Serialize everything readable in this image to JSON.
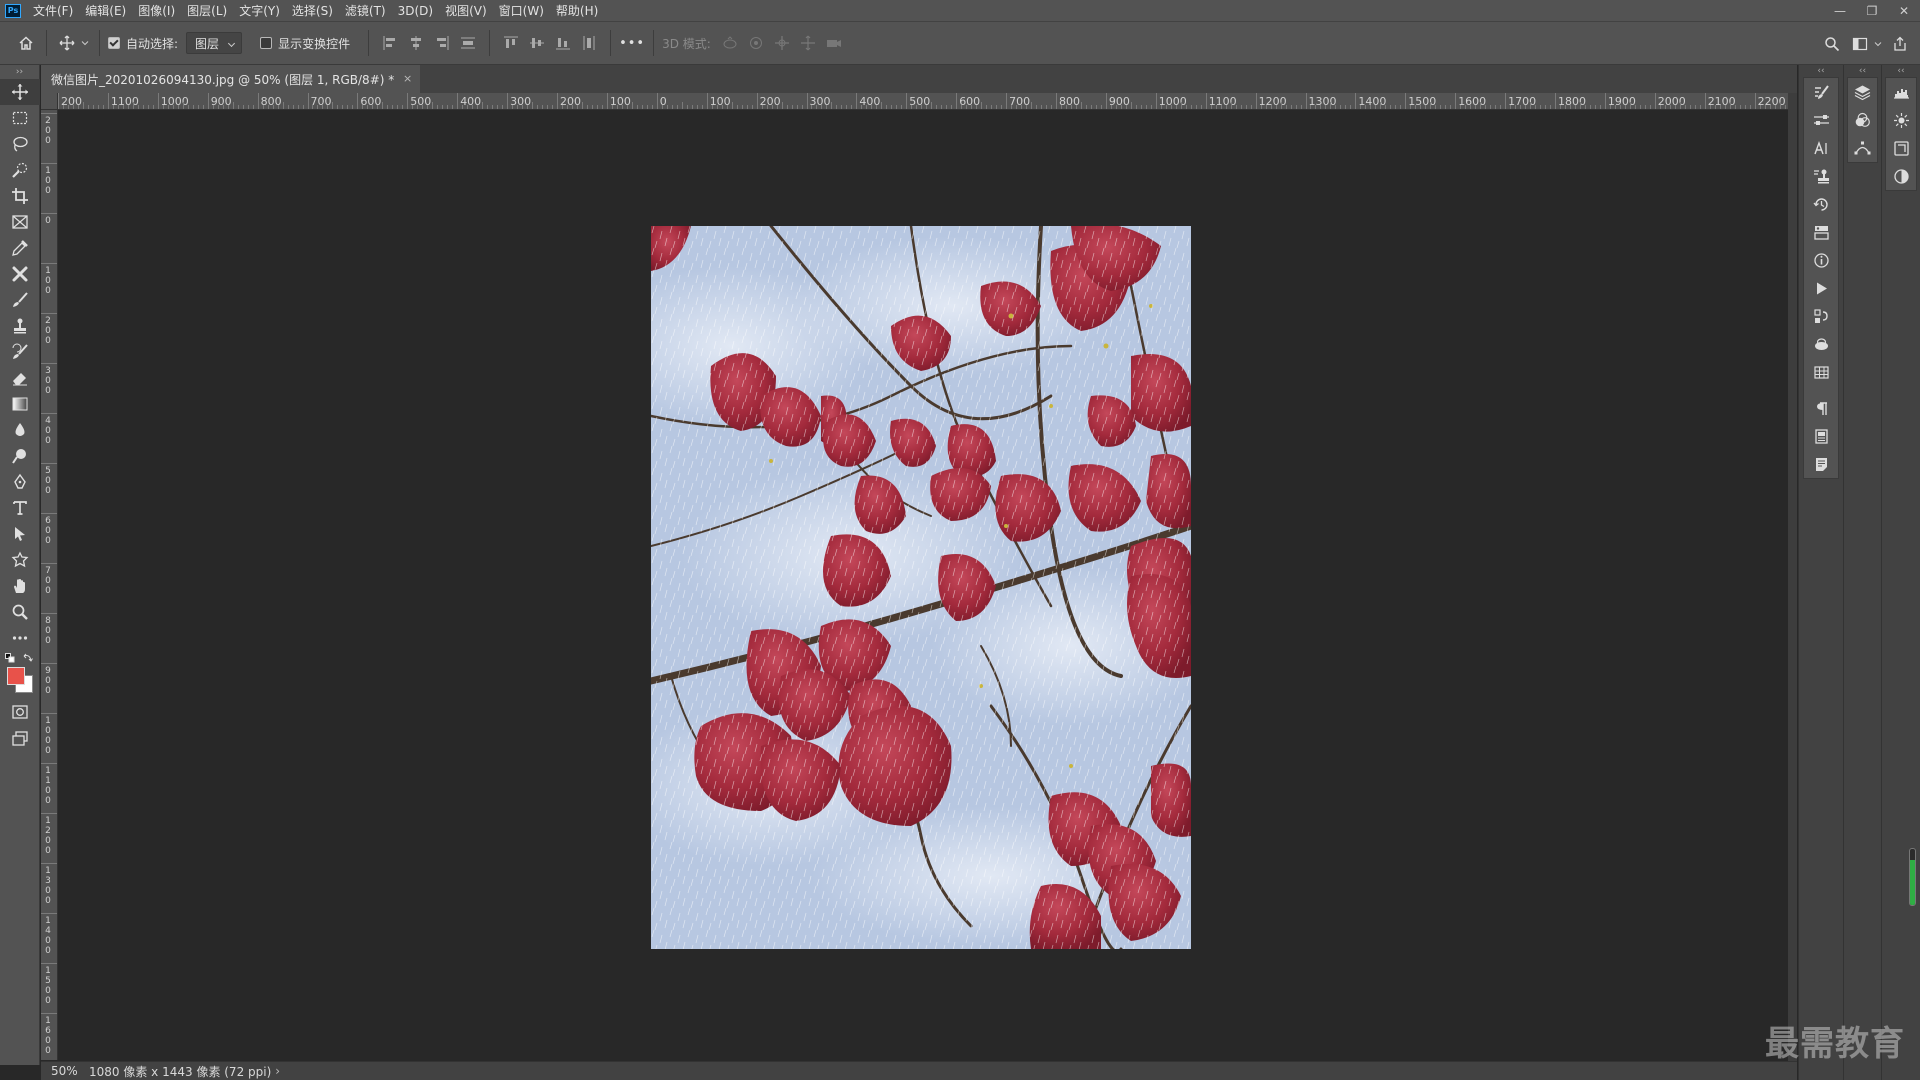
{
  "menubar": {
    "logo": "Ps",
    "items": [
      "文件(F)",
      "编辑(E)",
      "图像(I)",
      "图层(L)",
      "文字(Y)",
      "选择(S)",
      "滤镜(T)",
      "3D(D)",
      "视图(V)",
      "窗口(W)",
      "帮助(H)"
    ],
    "controls": {
      "minimize": "—",
      "restore": "❐",
      "close": "✕"
    }
  },
  "options": {
    "auto_select_label": "自动选择:",
    "auto_select_checked": true,
    "layer_select_value": "图层",
    "show_transform_label": "显示变换控件",
    "show_transform_checked": false,
    "more_label": "•••",
    "mode_3d_label": "3D 模式:"
  },
  "document": {
    "tab_title": "微信图片_20201026094130.jpg @ 50% (图层 1, RGB/8#) *",
    "close_glyph": "×"
  },
  "ruler_h_labels": [
    "200",
    "1100",
    "1000",
    "900",
    "800",
    "700",
    "600",
    "500",
    "400",
    "300",
    "200",
    "100",
    "0",
    "100",
    "200",
    "300",
    "400",
    "500",
    "600",
    "700",
    "800",
    "900",
    "1000",
    "1100",
    "1200",
    "1300",
    "1400",
    "1500",
    "1600",
    "1700",
    "1800",
    "1900",
    "2000",
    "2100",
    "2200"
  ],
  "ruler_v_labels": [
    "200",
    "100",
    "0",
    "100",
    "200",
    "300",
    "400",
    "500",
    "600",
    "700",
    "800",
    "900",
    "1000",
    "1100",
    "1200",
    "1300",
    "1400",
    "1500",
    "1600"
  ],
  "status": {
    "zoom": "50%",
    "info": "1080 像素 x 1443 像素 (72 ppi)",
    "arrow": "›"
  },
  "colors": {
    "foreground": "#e8524a",
    "background": "#ffffff",
    "ui_panel": "#535353",
    "ui_canvas": "#282828"
  },
  "tools": [
    "move-icon",
    "marquee-icon",
    "lasso-icon",
    "quick-select-icon",
    "crop-icon",
    "frame-icon",
    "eyedropper-icon",
    "healing-icon",
    "brush-icon",
    "stamp-icon",
    "history-brush-icon",
    "eraser-icon",
    "gradient-icon",
    "blur-icon",
    "dodge-icon",
    "pen-icon",
    "type-icon",
    "path-select-icon",
    "shape-icon",
    "hand-icon",
    "zoom-icon",
    "more-tools-icon"
  ],
  "watermark": "最需教育"
}
